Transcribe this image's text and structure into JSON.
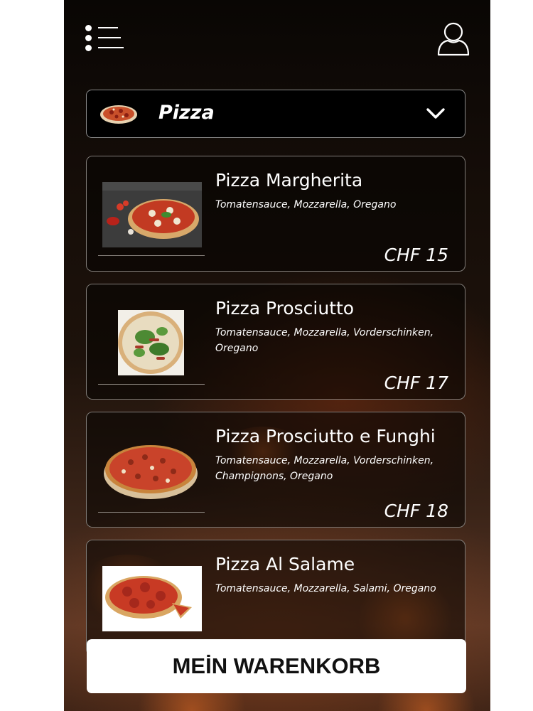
{
  "header": {
    "menu_icon": "menu-icon",
    "user_icon": "user-icon"
  },
  "category": {
    "label": "Pizza",
    "icon": "chevron-down-icon"
  },
  "products": [
    {
      "name": "Pizza Margherita",
      "description": "Tomatensauce, Mozzarella, Oregano",
      "price": "CHF 15"
    },
    {
      "name": "Pizza Prosciutto",
      "description": "Tomatensauce, Mozzarella, Vorderschinken, Oregano",
      "price": "CHF 17"
    },
    {
      "name": "Pizza Prosciutto e Funghi",
      "description": "Tomatensauce, Mozzarella, Vorderschinken, Champignons, Oregano",
      "price": "CHF 18"
    },
    {
      "name": "Pizza Al Salame",
      "description": "Tomatensauce, Mozzarella, Salami, Oregano",
      "price": ""
    }
  ],
  "cart": {
    "label": "MEİN WARENKORB"
  },
  "colors": {
    "background": "#1d120b",
    "card_border": "#7f7b77",
    "button_bg": "#ffffff",
    "text": "#ffffff"
  }
}
